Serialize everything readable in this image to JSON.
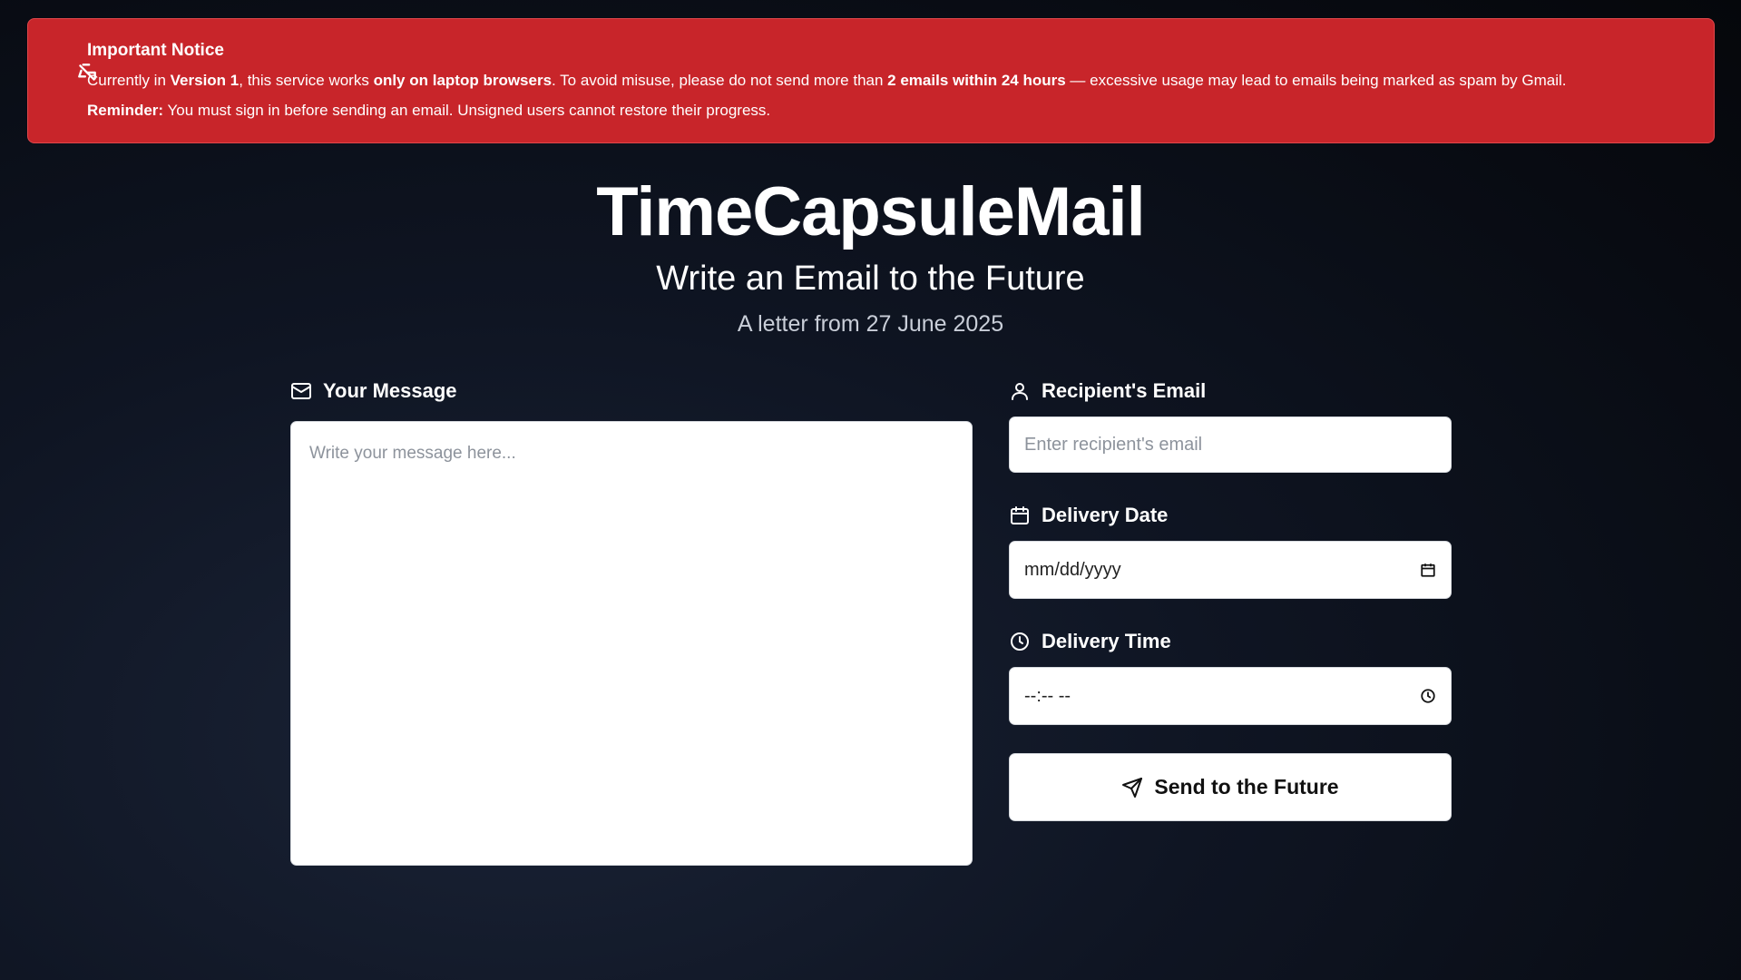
{
  "notice": {
    "icon": "no-laptop-icon",
    "title": "Important Notice",
    "line1": {
      "p1": "Currently in ",
      "b1": "Version 1",
      "p2": ", this service works ",
      "b2": "only on laptop browsers",
      "p3": ". To avoid misuse, please do not send more than ",
      "b3": "2 emails within 24 hours",
      "p4": " — excessive usage may lead to emails being marked as spam by Gmail."
    },
    "line2": {
      "b1": "Reminder:",
      "p1": " You must sign in before sending an email. Unsigned users cannot restore their progress."
    }
  },
  "header": {
    "title": "TimeCapsuleMail",
    "subtitle": "Write an Email to the Future",
    "dateline": "A letter from 27 June 2025"
  },
  "message": {
    "label": "Your Message",
    "placeholder": "Write your message here..."
  },
  "recipient": {
    "label": "Recipient's Email",
    "placeholder": "Enter recipient's email"
  },
  "delivery_date": {
    "label": "Delivery Date",
    "value": "mm/dd/yyyy"
  },
  "delivery_time": {
    "label": "Delivery Time",
    "value": "--:-- --"
  },
  "send_button": {
    "label": "Send to the Future"
  },
  "colors": {
    "notice_bg": "#c8252a",
    "background": "#0f1523"
  }
}
